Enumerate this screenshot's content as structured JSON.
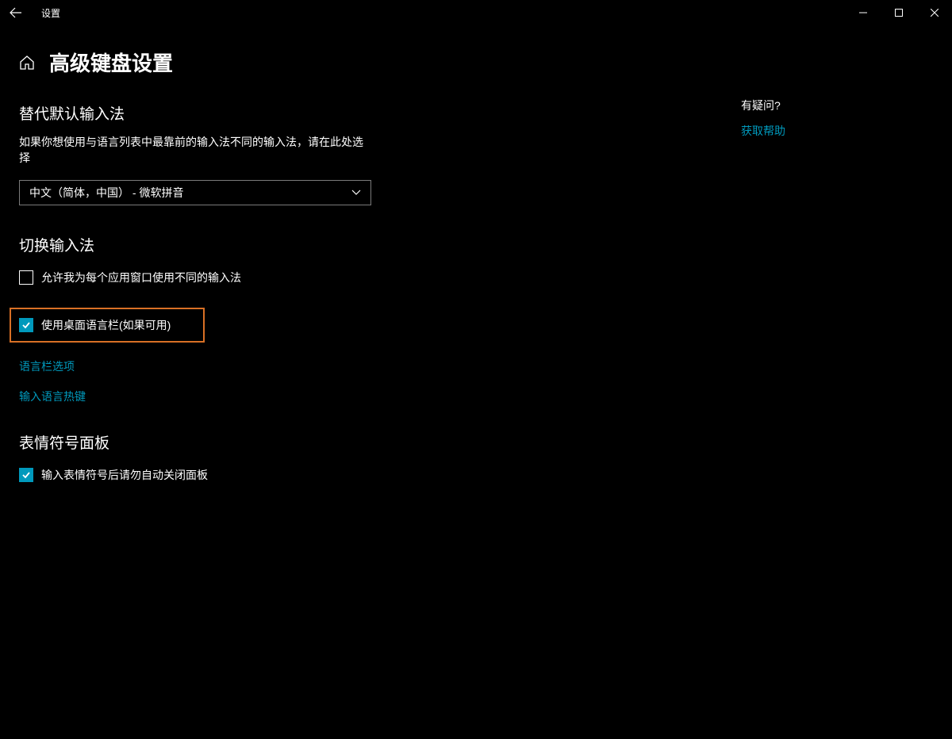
{
  "titlebar": {
    "title": "设置"
  },
  "header": {
    "page_title": "高级键盘设置"
  },
  "section1": {
    "title": "替代默认输入法",
    "desc": "如果你想使用与语言列表中最靠前的输入法不同的输入法，请在此处选择",
    "dropdown_value": "中文（简体，中国） - 微软拼音"
  },
  "section2": {
    "title": "切换输入法",
    "checkbox1_label": "允许我为每个应用窗口使用不同的输入法",
    "checkbox2_label": "使用桌面语言栏(如果可用)",
    "link1": "语言栏选项",
    "link2": "输入语言热键"
  },
  "section3": {
    "title": "表情符号面板",
    "checkbox_label": "输入表情符号后请勿自动关闭面板"
  },
  "sidebar": {
    "heading": "有疑问?",
    "link": "获取帮助"
  }
}
